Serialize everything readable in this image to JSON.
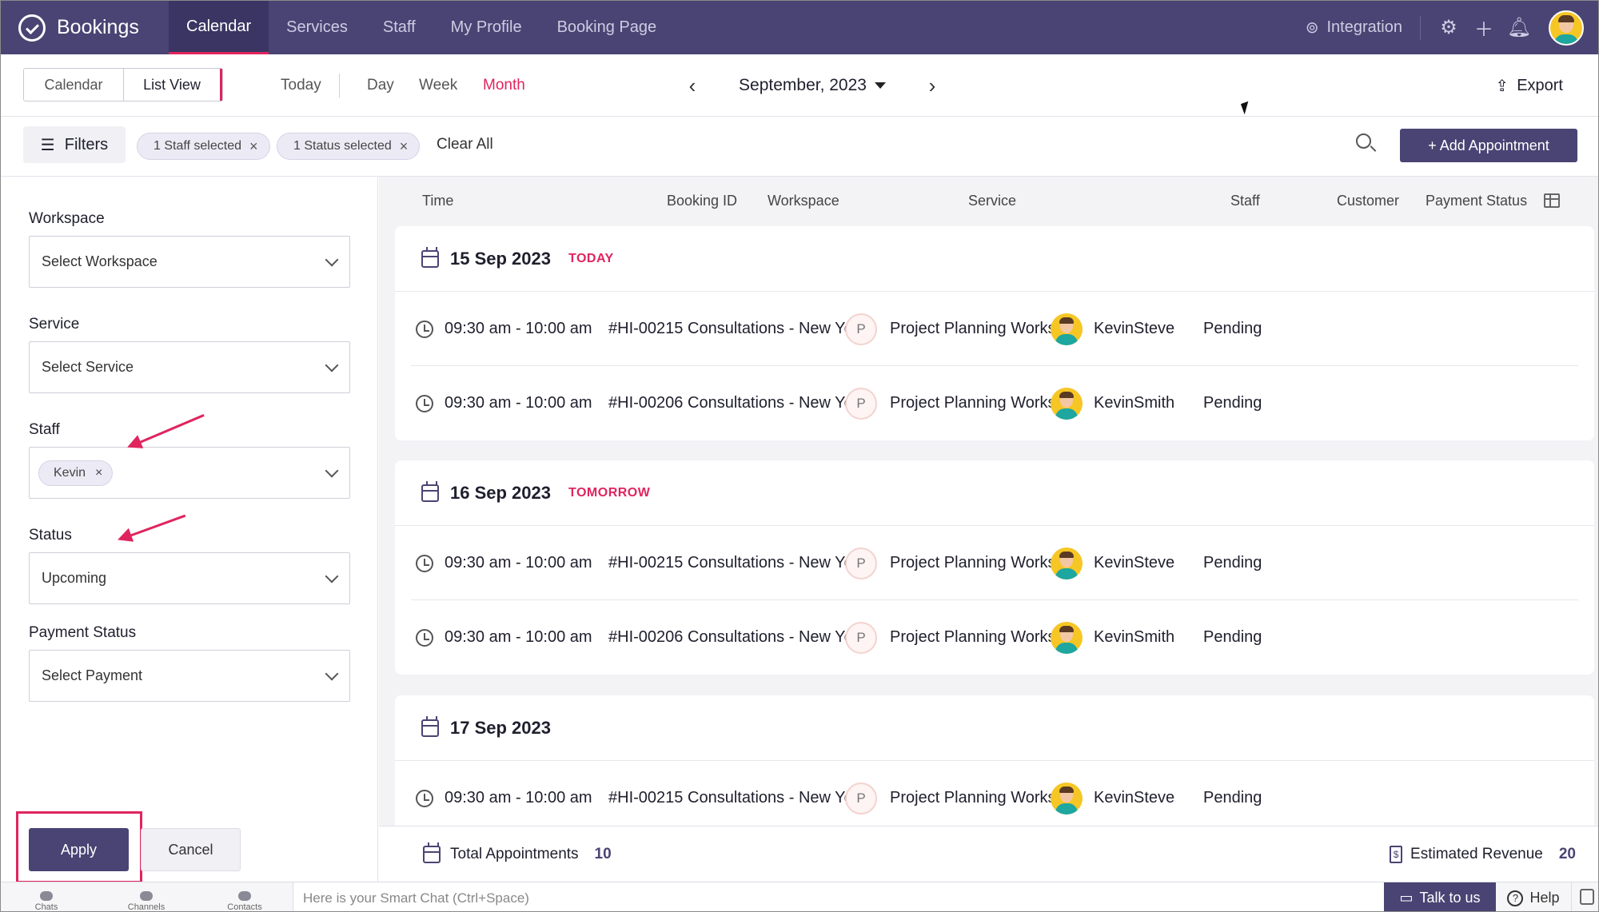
{
  "app": {
    "name": "Bookings"
  },
  "nav": {
    "tabs": [
      "Calendar",
      "Services",
      "Staff",
      "My Profile",
      "Booking Page"
    ],
    "integration": "Integration"
  },
  "toolbar": {
    "views": [
      "Calendar",
      "List View"
    ],
    "ranges": [
      "Today",
      "Day",
      "Week",
      "Month"
    ],
    "current_month": "September, 2023",
    "export": "Export"
  },
  "filterbar": {
    "filters_label": "Filters",
    "chips": [
      "1 Staff selected",
      "1 Status selected"
    ],
    "clear_all": "Clear All",
    "add_appointment": "+ Add Appointment"
  },
  "sidebar": {
    "workspace": {
      "label": "Workspace",
      "value": "Select Workspace"
    },
    "service": {
      "label": "Service",
      "value": "Select Service"
    },
    "staff": {
      "label": "Staff",
      "tag": "Kevin"
    },
    "status": {
      "label": "Status",
      "value": "Upcoming"
    },
    "payment": {
      "label": "Payment Status",
      "value": "Select Payment"
    },
    "apply": "Apply",
    "cancel": "Cancel"
  },
  "table": {
    "columns": [
      "Time",
      "Booking ID",
      "Workspace",
      "Service",
      "Staff",
      "Customer",
      "Payment Status"
    ],
    "groups": [
      {
        "date": "15 Sep 2023",
        "tag": "TODAY",
        "rows": [
          {
            "time": "09:30 am - 10:00 am",
            "id": "#HI-00215",
            "workspace": "Consultations - New York",
            "service_initial": "P",
            "service": "Project Planning Workshop",
            "staff": "Kevin",
            "customer": "Steve",
            "payment": "Pending"
          },
          {
            "time": "09:30 am - 10:00 am",
            "id": "#HI-00206",
            "workspace": "Consultations - New York",
            "service_initial": "P",
            "service": "Project Planning Workshop",
            "staff": "Kevin",
            "customer": "Smith",
            "payment": "Pending"
          }
        ]
      },
      {
        "date": "16 Sep 2023",
        "tag": "TOMORROW",
        "rows": [
          {
            "time": "09:30 am - 10:00 am",
            "id": "#HI-00215",
            "workspace": "Consultations - New York",
            "service_initial": "P",
            "service": "Project Planning Workshop",
            "staff": "Kevin",
            "customer": "Steve",
            "payment": "Pending"
          },
          {
            "time": "09:30 am - 10:00 am",
            "id": "#HI-00206",
            "workspace": "Consultations - New York",
            "service_initial": "P",
            "service": "Project Planning Workshop",
            "staff": "Kevin",
            "customer": "Smith",
            "payment": "Pending"
          }
        ]
      },
      {
        "date": "17 Sep 2023",
        "tag": "",
        "rows": [
          {
            "time": "09:30 am - 10:00 am",
            "id": "#HI-00215",
            "workspace": "Consultations - New York",
            "service_initial": "P",
            "service": "Project Planning Workshop",
            "staff": "Kevin",
            "customer": "Steve",
            "payment": "Pending"
          }
        ]
      }
    ]
  },
  "footer": {
    "total_label": "Total Appointments",
    "total_value": "10",
    "revenue_label": "Estimated Revenue",
    "revenue_value": "20"
  },
  "bottombar": {
    "items": [
      "Chats",
      "Channels",
      "Contacts"
    ],
    "smartchat_placeholder": "Here is your Smart Chat (Ctrl+Space)",
    "talk": "Talk to us",
    "help": "Help"
  },
  "colors": {
    "brand": "#4a4474",
    "accent": "#e0245e"
  }
}
